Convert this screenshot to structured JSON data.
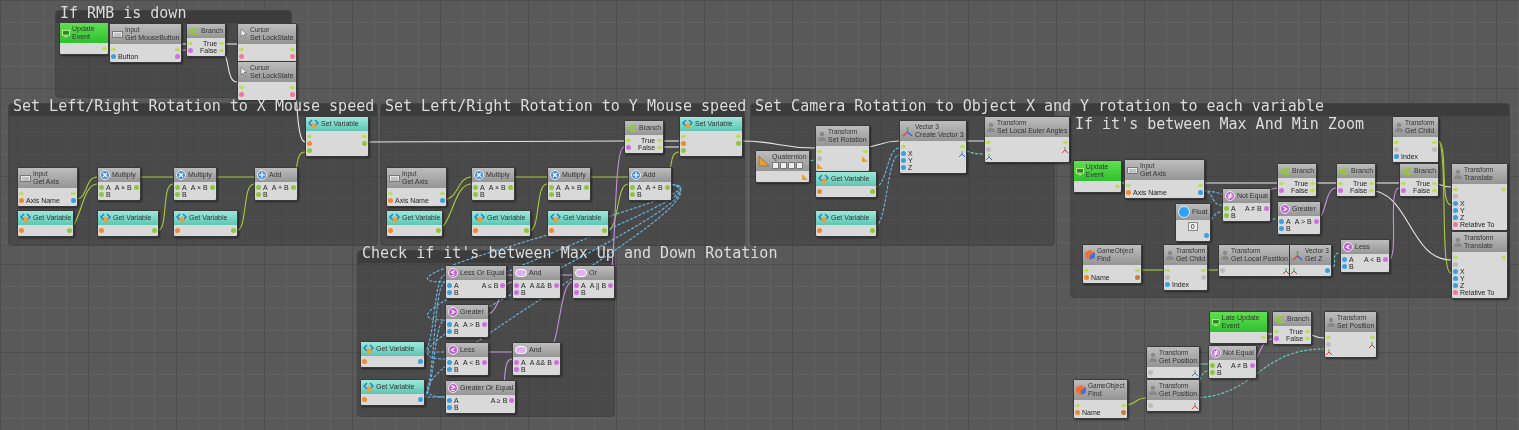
{
  "groups": [
    {
      "title": "If RMB is down"
    },
    {
      "title": "Set Left/Right Rotation to X Mouse speed"
    },
    {
      "title": "Set Left/Right Rotation to Y Mouse speed"
    },
    {
      "title": "Set Camera Rotation to Object X and Y rotation to each variable"
    },
    {
      "title": "If it's between Max And Min Zoom"
    },
    {
      "title": "Check if it's between Max Up and Down Rotation"
    }
  ],
  "nodes": [
    {
      "kind": "event",
      "title": "Update Event",
      "rows": [
        {
          "right": {
            "kind": "exec"
          }
        }
      ]
    },
    {
      "kind": "input",
      "category": "Input",
      "title": "Get MouseButton",
      "rows": [
        {
          "left": {
            "kind": "exec"
          },
          "right": {
            "kind": "exec"
          }
        },
        {
          "left": {
            "kind": "int",
            "label": "Button"
          },
          "right": {
            "kind": "bool"
          }
        }
      ]
    },
    {
      "kind": "branch",
      "title": "Branch",
      "rows": [
        {
          "left": {
            "kind": "exec"
          },
          "right": {
            "kind": "exec",
            "label": "True"
          }
        },
        {
          "left": {
            "kind": "bool"
          },
          "right": {
            "kind": "exec",
            "label": "False"
          }
        }
      ]
    },
    {
      "kind": "cursor",
      "category": "Cursor",
      "title": "Set LockState",
      "rows": [
        {
          "left": {
            "kind": "exec"
          },
          "right": {
            "kind": "exec"
          }
        },
        {
          "left": {
            "kind": "object"
          },
          "right": {
            "kind": "object"
          }
        }
      ]
    },
    {
      "kind": "cursor",
      "category": "Cursor",
      "title": "Set LockState",
      "rows": [
        {
          "left": {
            "kind": "exec"
          },
          "right": {
            "kind": "exec"
          }
        },
        {
          "left": {
            "kind": "object"
          },
          "right": {
            "kind": "object"
          }
        }
      ]
    },
    {
      "kind": "set_variable",
      "title": "Set Variable",
      "rows": [
        {
          "left": {
            "kind": "exec"
          },
          "right": {
            "kind": "exec"
          }
        },
        {
          "left": {
            "kind": "string"
          },
          "right": {
            "kind": "float"
          }
        },
        {
          "left": {
            "kind": "float"
          }
        }
      ]
    },
    {
      "kind": "input",
      "category": "Input",
      "title": "Get Axis",
      "rows": [
        {
          "left": {
            "kind": "exec"
          },
          "right": {
            "kind": "exec"
          }
        },
        {
          "left": {
            "kind": "string",
            "label": "Axis Name"
          },
          "right": {
            "kind": "int"
          }
        }
      ]
    },
    {
      "kind": "multiply",
      "title": "Multiply",
      "rows": [
        {
          "left": {
            "kind": "float",
            "label": "A"
          },
          "right": {
            "kind": "float",
            "label": "A × B"
          }
        },
        {
          "left": {
            "kind": "float",
            "label": "B"
          }
        }
      ]
    },
    {
      "kind": "multiply",
      "title": "Multiply",
      "rows": [
        {
          "left": {
            "kind": "float",
            "label": "A"
          },
          "right": {
            "kind": "float",
            "label": "A × B"
          }
        },
        {
          "left": {
            "kind": "float",
            "label": "B"
          }
        }
      ]
    },
    {
      "kind": "add",
      "title": "Add",
      "rows": [
        {
          "left": {
            "kind": "float",
            "label": "A"
          },
          "right": {
            "kind": "float",
            "label": "A + B"
          }
        },
        {
          "left": {
            "kind": "float",
            "label": "B"
          }
        }
      ]
    },
    {
      "kind": "get_variable",
      "title": "Get Variable",
      "rows": [
        {
          "left": {
            "kind": "string"
          },
          "right": {
            "kind": "float"
          }
        }
      ]
    },
    {
      "kind": "get_variable",
      "title": "Get Variable",
      "rows": [
        {
          "left": {
            "kind": "string"
          },
          "right": {
            "kind": "float"
          }
        }
      ]
    },
    {
      "kind": "get_variable",
      "title": "Get Variable",
      "rows": [
        {
          "left": {
            "kind": "string"
          },
          "right": {
            "kind": "float"
          }
        }
      ]
    },
    {
      "kind": "branch",
      "title": "Branch",
      "rows": [
        {
          "left": {
            "kind": "exec"
          },
          "right": {
            "kind": "exec",
            "label": "True"
          }
        },
        {
          "left": {
            "kind": "bool"
          },
          "right": {
            "kind": "exec",
            "label": "False"
          }
        }
      ]
    },
    {
      "kind": "set_variable",
      "title": "Set Variable",
      "rows": [
        {
          "left": {
            "kind": "exec"
          },
          "right": {
            "kind": "exec"
          }
        },
        {
          "left": {
            "kind": "string"
          },
          "right": {
            "kind": "float"
          }
        },
        {
          "left": {
            "kind": "float"
          }
        }
      ]
    },
    {
      "kind": "input",
      "category": "Input",
      "title": "Get Axis",
      "rows": [
        {
          "left": {
            "kind": "exec"
          },
          "right": {
            "kind": "exec"
          }
        },
        {
          "left": {
            "kind": "string",
            "label": "Axis Name"
          },
          "right": {
            "kind": "int"
          }
        }
      ]
    },
    {
      "kind": "multiply",
      "title": "Multiply",
      "rows": [
        {
          "left": {
            "kind": "float",
            "label": "A"
          },
          "right": {
            "kind": "float",
            "label": "A × B"
          }
        },
        {
          "left": {
            "kind": "float",
            "label": "B"
          }
        }
      ]
    },
    {
      "kind": "multiply",
      "title": "Multiply",
      "rows": [
        {
          "left": {
            "kind": "float",
            "label": "A"
          },
          "right": {
            "kind": "float",
            "label": "A × B"
          }
        },
        {
          "left": {
            "kind": "float",
            "label": "B"
          }
        }
      ]
    },
    {
      "kind": "add",
      "title": "Add",
      "rows": [
        {
          "left": {
            "kind": "float",
            "label": "A"
          },
          "right": {
            "kind": "float",
            "label": "A + B"
          }
        },
        {
          "left": {
            "kind": "float",
            "label": "B"
          }
        }
      ]
    },
    {
      "kind": "get_variable",
      "title": "Get Variable",
      "rows": [
        {
          "left": {
            "kind": "string"
          },
          "right": {
            "kind": "float"
          }
        }
      ]
    },
    {
      "kind": "get_variable",
      "title": "Get Variable",
      "rows": [
        {
          "left": {
            "kind": "string"
          },
          "right": {
            "kind": "float"
          }
        }
      ]
    },
    {
      "kind": "get_variable",
      "title": "Get Variable",
      "rows": [
        {
          "left": {
            "kind": "string"
          },
          "right": {
            "kind": "float"
          }
        }
      ]
    },
    {
      "kind": "transform",
      "category": "Transform",
      "title": "Set Rotation",
      "rows": [
        {
          "left": {
            "kind": "exec"
          },
          "right": {
            "kind": "exec"
          }
        },
        {
          "left": {
            "kind": "target"
          },
          "right": {
            "kind": "quat"
          }
        },
        {
          "left": {
            "kind": "quat"
          }
        }
      ]
    },
    {
      "kind": "quaternion",
      "title": "Quaternion",
      "rows": [
        {
          "right": {
            "kind": "quat"
          }
        }
      ]
    },
    {
      "kind": "get_variable",
      "title": "Get Variable",
      "rows": [
        {
          "left": {
            "kind": "string"
          },
          "right": {
            "kind": "float"
          }
        }
      ]
    },
    {
      "kind": "get_variable",
      "title": "Get Variable",
      "rows": [
        {
          "left": {
            "kind": "string"
          },
          "right": {
            "kind": "float"
          }
        }
      ]
    },
    {
      "kind": "vector",
      "category": "Vector 3",
      "title": "Create Vector 3",
      "rows": [
        {
          "left": {
            "kind": "exec"
          },
          "right": {
            "kind": "exec"
          }
        },
        {
          "left": {
            "kind": "int",
            "label": "X"
          },
          "right": {
            "kind": "vector"
          }
        },
        {
          "left": {
            "kind": "int",
            "label": "Y"
          }
        },
        {
          "left": {
            "kind": "int",
            "label": "Z"
          }
        }
      ]
    },
    {
      "kind": "transform",
      "category": "Transform",
      "title": "Set Local Euler Angles",
      "rows": [
        {
          "left": {
            "kind": "exec"
          },
          "right": {
            "kind": "exec"
          }
        },
        {
          "left": {
            "kind": "target"
          },
          "right": {
            "kind": "vector"
          }
        },
        {
          "left": {
            "kind": "vector"
          }
        }
      ]
    },
    {
      "kind": "event",
      "title": "Update Event",
      "rows": [
        {
          "right": {
            "kind": "exec"
          }
        }
      ]
    },
    {
      "kind": "input",
      "category": "Input",
      "title": "Get Axis",
      "rows": [
        {
          "left": {
            "kind": "exec"
          },
          "right": {
            "kind": "exec"
          }
        },
        {
          "left": {
            "kind": "string",
            "label": "Axis Name"
          },
          "right": {
            "kind": "int"
          }
        }
      ]
    },
    {
      "kind": "not_equal",
      "title": "Not Equal",
      "rows": [
        {
          "left": {
            "kind": "float",
            "label": "A"
          },
          "right": {
            "kind": "bool",
            "label": "A ≠ B"
          }
        },
        {
          "left": {
            "kind": "float",
            "label": "B"
          }
        }
      ]
    },
    {
      "kind": "float",
      "title": "Float",
      "value": "0",
      "rows": [
        {
          "right": {
            "kind": "int"
          }
        }
      ]
    },
    {
      "kind": "branch",
      "title": "Branch",
      "rows": [
        {
          "left": {
            "kind": "exec"
          },
          "right": {
            "kind": "exec",
            "label": "True"
          }
        },
        {
          "left": {
            "kind": "bool"
          },
          "right": {
            "kind": "exec",
            "label": "False"
          }
        }
      ]
    },
    {
      "kind": "greater",
      "title": "Greater",
      "rows": [
        {
          "left": {
            "kind": "int",
            "label": "A"
          },
          "right": {
            "kind": "bool",
            "label": "A > B"
          }
        },
        {
          "left": {
            "kind": "int",
            "label": "B"
          }
        }
      ]
    },
    {
      "kind": "branch",
      "title": "Branch",
      "rows": [
        {
          "left": {
            "kind": "exec"
          },
          "right": {
            "kind": "exec",
            "label": "True"
          }
        },
        {
          "left": {
            "kind": "bool"
          },
          "right": {
            "kind": "exec",
            "label": "False"
          }
        }
      ]
    },
    {
      "kind": "transform",
      "category": "Transform",
      "title": "Get Child",
      "rows": [
        {
          "left": {
            "kind": "exec"
          },
          "right": {
            "kind": "exec"
          }
        },
        {
          "left": {
            "kind": "target"
          },
          "right": {
            "kind": "target"
          }
        },
        {
          "left": {
            "kind": "int",
            "label": "Index"
          }
        }
      ]
    },
    {
      "kind": "branch",
      "title": "Branch",
      "rows": [
        {
          "left": {
            "kind": "exec"
          },
          "right": {
            "kind": "exec",
            "label": "True"
          }
        },
        {
          "left": {
            "kind": "bool"
          },
          "right": {
            "kind": "exec",
            "label": "False"
          }
        }
      ]
    },
    {
      "kind": "transform",
      "category": "Transform",
      "title": "Translate",
      "rows": [
        {
          "left": {
            "kind": "exec"
          },
          "right": {
            "kind": "exec"
          }
        },
        {
          "left": {
            "kind": "target"
          }
        },
        {
          "left": {
            "kind": "int",
            "label": "X"
          }
        },
        {
          "left": {
            "kind": "int",
            "label": "Y"
          }
        },
        {
          "left": {
            "kind": "int",
            "label": "Z"
          }
        },
        {
          "left": {
            "kind": "object",
            "label": "Relative To"
          }
        }
      ]
    },
    {
      "kind": "gameobject",
      "category": "GameObject",
      "title": "Find",
      "rows": [
        {
          "left": {
            "kind": "exec"
          },
          "right": {
            "kind": "exec"
          }
        },
        {
          "left": {
            "kind": "string",
            "label": "Name"
          },
          "right": {
            "kind": "gameobject"
          }
        }
      ]
    },
    {
      "kind": "transform",
      "category": "Transform",
      "title": "Get Child",
      "rows": [
        {
          "left": {
            "kind": "exec"
          },
          "right": {
            "kind": "exec"
          }
        },
        {
          "left": {
            "kind": "target"
          },
          "right": {
            "kind": "target"
          }
        },
        {
          "left": {
            "kind": "int",
            "label": "Index"
          }
        }
      ]
    },
    {
      "kind": "transform",
      "category": "Transform",
      "title": "Get Local Position",
      "rows": [
        {
          "left": {
            "kind": "target"
          },
          "right": {
            "kind": "vector"
          }
        }
      ]
    },
    {
      "kind": "vector",
      "category": "Vector 3",
      "title": "Get Z",
      "rows": [
        {
          "left": {
            "kind": "vector"
          },
          "right": {
            "kind": "int"
          }
        }
      ]
    },
    {
      "kind": "less",
      "title": "Less",
      "rows": [
        {
          "left": {
            "kind": "int",
            "label": "A"
          },
          "right": {
            "kind": "bool",
            "label": "A < B"
          }
        },
        {
          "left": {
            "kind": "int",
            "label": "B"
          }
        }
      ]
    },
    {
      "kind": "transform",
      "category": "Transform",
      "title": "Translate",
      "rows": [
        {
          "left": {
            "kind": "exec"
          },
          "right": {
            "kind": "exec"
          }
        },
        {
          "left": {
            "kind": "target"
          }
        },
        {
          "left": {
            "kind": "int",
            "label": "X"
          }
        },
        {
          "left": {
            "kind": "int",
            "label": "Y"
          }
        },
        {
          "left": {
            "kind": "int",
            "label": "Z"
          }
        },
        {
          "left": {
            "kind": "object",
            "label": "Relative To"
          }
        }
      ]
    },
    {
      "kind": "event",
      "title": "Late Update Event",
      "rows": [
        {
          "right": {
            "kind": "exec"
          }
        }
      ]
    },
    {
      "kind": "branch",
      "title": "Branch",
      "rows": [
        {
          "left": {
            "kind": "exec"
          },
          "right": {
            "kind": "exec",
            "label": "True"
          }
        },
        {
          "left": {
            "kind": "bool"
          },
          "right": {
            "kind": "exec",
            "label": "False"
          }
        }
      ]
    },
    {
      "kind": "transform",
      "category": "Transform",
      "title": "Set Position",
      "rows": [
        {
          "left": {
            "kind": "exec"
          },
          "right": {
            "kind": "exec"
          }
        },
        {
          "left": {
            "kind": "target"
          },
          "right": {
            "kind": "vector"
          }
        },
        {
          "left": {
            "kind": "vector"
          }
        }
      ]
    },
    {
      "kind": "transform",
      "category": "Transform",
      "title": "Get Position",
      "rows": [
        {
          "left": {
            "kind": "target"
          },
          "right": {
            "kind": "vector"
          }
        }
      ]
    },
    {
      "kind": "not_equal",
      "title": "Not Equal",
      "rows": [
        {
          "left": {
            "kind": "float",
            "label": "A"
          },
          "right": {
            "kind": "bool",
            "label": "A ≠ B"
          }
        },
        {
          "left": {
            "kind": "float",
            "label": "B"
          }
        }
      ]
    },
    {
      "kind": "gameobject",
      "category": "GameObject",
      "title": "Find",
      "rows": [
        {
          "left": {
            "kind": "exec"
          },
          "right": {
            "kind": "exec"
          }
        },
        {
          "left": {
            "kind": "string",
            "label": "Name"
          },
          "right": {
            "kind": "gameobject"
          }
        }
      ]
    },
    {
      "kind": "transform",
      "category": "Transform",
      "title": "Get Position",
      "rows": [
        {
          "left": {
            "kind": "target"
          },
          "right": {
            "kind": "vector"
          }
        }
      ]
    },
    {
      "kind": "less_equal",
      "title": "Less Or Equal",
      "rows": [
        {
          "left": {
            "kind": "int",
            "label": "A"
          },
          "right": {
            "kind": "bool",
            "label": "A ≤ B"
          }
        },
        {
          "left": {
            "kind": "int",
            "label": "B"
          }
        }
      ]
    },
    {
      "kind": "and",
      "title": "And",
      "rows": [
        {
          "left": {
            "kind": "bool",
            "label": "A"
          },
          "right": {
            "kind": "bool",
            "label": "A && B"
          }
        },
        {
          "left": {
            "kind": "bool",
            "label": "B"
          }
        }
      ]
    },
    {
      "kind": "or",
      "title": "Or",
      "rows": [
        {
          "left": {
            "kind": "bool",
            "label": "A"
          },
          "right": {
            "kind": "bool",
            "label": "A || B"
          }
        },
        {
          "left": {
            "kind": "bool",
            "label": "B"
          }
        }
      ]
    },
    {
      "kind": "greater",
      "title": "Greater",
      "rows": [
        {
          "left": {
            "kind": "int",
            "label": "A"
          },
          "right": {
            "kind": "bool",
            "label": "A > B"
          }
        },
        {
          "left": {
            "kind": "int",
            "label": "B"
          }
        }
      ]
    },
    {
      "kind": "get_variable",
      "title": "Get Variable",
      "rows": [
        {
          "left": {
            "kind": "string"
          },
          "right": {
            "kind": "int"
          }
        }
      ]
    },
    {
      "kind": "less",
      "title": "Less",
      "rows": [
        {
          "left": {
            "kind": "int",
            "label": "A"
          },
          "right": {
            "kind": "bool",
            "label": "A < B"
          }
        },
        {
          "left": {
            "kind": "int",
            "label": "B"
          }
        }
      ]
    },
    {
      "kind": "and",
      "title": "And",
      "rows": [
        {
          "left": {
            "kind": "bool",
            "label": "A"
          },
          "right": {
            "kind": "bool",
            "label": "A && B"
          }
        },
        {
          "left": {
            "kind": "bool",
            "label": "B"
          }
        }
      ]
    },
    {
      "kind": "get_variable",
      "title": "Get Variable",
      "rows": [
        {
          "left": {
            "kind": "string"
          },
          "right": {
            "kind": "int"
          }
        }
      ]
    },
    {
      "kind": "greater_equal",
      "title": "Greater Or Equal",
      "rows": [
        {
          "left": {
            "kind": "int",
            "label": "A"
          },
          "right": {
            "kind": "bool",
            "label": "A ≥ B"
          }
        },
        {
          "left": {
            "kind": "int",
            "label": "B"
          }
        }
      ]
    }
  ]
}
